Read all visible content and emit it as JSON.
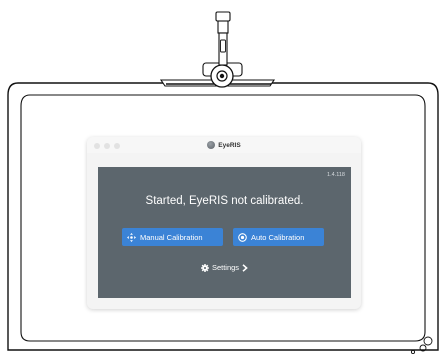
{
  "app": {
    "title": "EyeRIS",
    "version": "1.4.118",
    "status": "Started, EyeRIS not calibrated."
  },
  "buttons": {
    "manual_label": "Manual Calibration",
    "auto_label": "Auto Calibration",
    "settings_label": "Settings"
  },
  "colors": {
    "panel": "#5c666d",
    "accent": "#3b83d6",
    "window": "#f4f4f4"
  },
  "icons": {
    "manual": "crosshair-arrows-icon",
    "auto": "target-icon",
    "settings": "gear-icon",
    "settings_chevron": "chevron-right-icon"
  }
}
